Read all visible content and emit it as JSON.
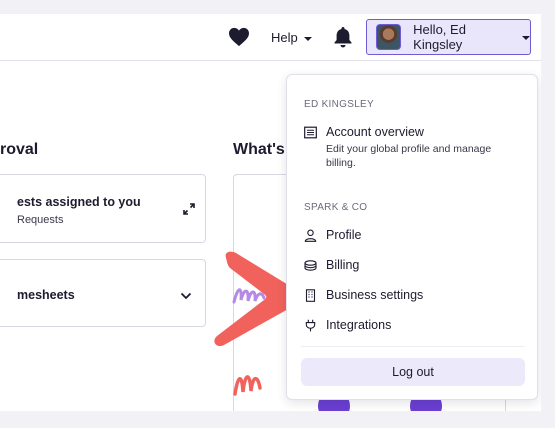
{
  "header": {
    "help_label": "Help",
    "user_label": "Hello, Ed Kingsley"
  },
  "dashboard": {
    "left_section_title": "roval",
    "right_section_title": "What's",
    "cards": [
      {
        "title": "ests assigned to you",
        "subtitle": "Requests"
      },
      {
        "title": "mesheets"
      }
    ]
  },
  "menu": {
    "user_heading": "ED KINGSLEY",
    "account_overview": {
      "label": "Account overview",
      "description": "Edit your global profile and manage billing."
    },
    "org_heading": "SPARK & CO",
    "items": [
      {
        "label": "Profile",
        "icon": "person-icon"
      },
      {
        "label": "Billing",
        "icon": "coins-icon"
      },
      {
        "label": "Business settings",
        "icon": "building-icon"
      },
      {
        "label": "Integrations",
        "icon": "plug-icon"
      }
    ],
    "logout_label": "Log out"
  },
  "colors": {
    "accent": "#6f5bd6",
    "accent_light": "#e9e6fb",
    "annotation_arrow": "#f2625c",
    "doodle_purple": "#b48ae6"
  }
}
